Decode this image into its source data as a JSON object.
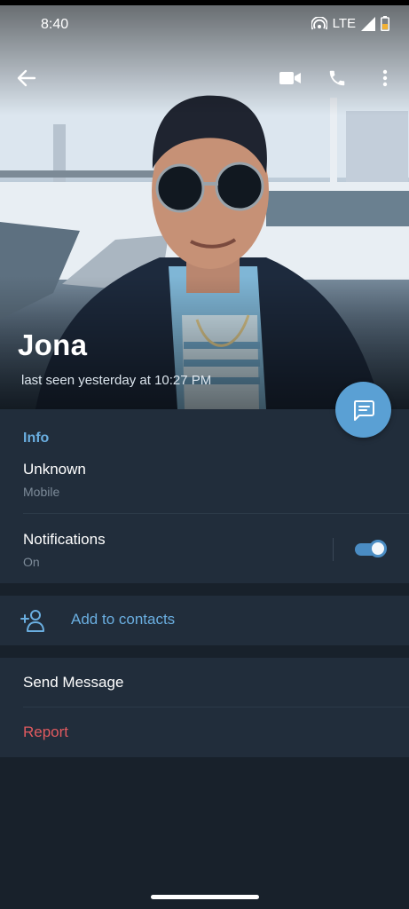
{
  "status_bar": {
    "time": "8:40",
    "network": "LTE",
    "icons": [
      "hotspot-icon",
      "signal-icon",
      "battery-icon"
    ],
    "battery_color": "#f2b134"
  },
  "app_bar": {
    "icons": [
      "back-arrow-icon",
      "video-call-icon",
      "phone-call-icon",
      "more-vert-icon"
    ]
  },
  "profile": {
    "name": "Jona",
    "last_seen": "last seen yesterday at 10:27 PM"
  },
  "fab": {
    "icon": "message-icon",
    "color": "#5aa0d4"
  },
  "info": {
    "title": "Info",
    "phone_value": "Unknown",
    "phone_label": "Mobile",
    "notifications_label": "Notifications",
    "notifications_value": "On",
    "notifications_enabled": true
  },
  "contacts": {
    "icon": "add-person-icon",
    "label": "Add to contacts"
  },
  "actions": {
    "send_message": "Send Message",
    "report": "Report"
  },
  "colors": {
    "accent": "#6aaee0",
    "danger": "#e05a5f",
    "surface": "#212d3b",
    "background": "#18212b"
  }
}
